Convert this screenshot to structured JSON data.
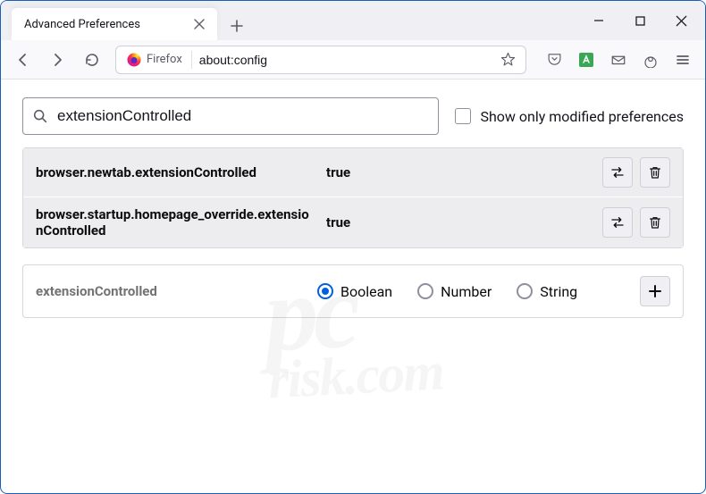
{
  "window": {
    "tab_title": "Advanced Preferences"
  },
  "urlbar": {
    "identity_label": "Firefox",
    "url": "about:config"
  },
  "search": {
    "value": "extensionControlled",
    "checkbox_label": "Show only modified preferences"
  },
  "prefs": [
    {
      "name": "browser.newtab.extensionControlled",
      "value": "true"
    },
    {
      "name": "browser.startup.homepage_override.extensionControlled",
      "value": "true"
    }
  ],
  "new_pref": {
    "name": "extensionControlled",
    "types": {
      "boolean": "Boolean",
      "number": "Number",
      "string": "String"
    },
    "selected": "boolean"
  },
  "watermark": {
    "main": "pc",
    "sub": "risk.com"
  }
}
